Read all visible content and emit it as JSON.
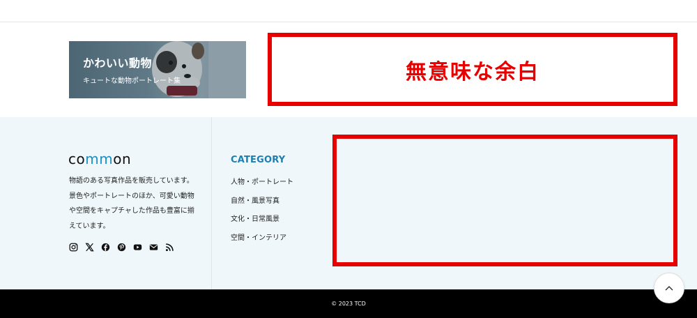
{
  "banner": {
    "title": "かわいい動物",
    "subtitle": "キュートな動物ポートレート集"
  },
  "annotation": {
    "top_label": "無意味な余白",
    "color": "#e60000"
  },
  "footer": {
    "logo": {
      "prefix": "co",
      "highlight": "mm",
      "suffix": "on",
      "accent_color": "#1a8fc4"
    },
    "description_lines": [
      "物語のある写真作品を販売しています。",
      "景色やポートレートのほか、可愛い動物",
      "や空間をキャプチャした作品も豊富に揃",
      "えています。"
    ],
    "socials": [
      "instagram-icon",
      "x-icon",
      "facebook-icon",
      "pinterest-icon",
      "youtube-icon",
      "mail-icon",
      "rss-icon"
    ],
    "category": {
      "heading": "CATEGORY",
      "items": [
        "人物・ポートレート",
        "自然・風景写真",
        "文化・日常風景",
        "空間・インテリア"
      ]
    },
    "copyright": "© 2023 TCD"
  },
  "colors": {
    "footer_bg": "#eff7fa",
    "category_heading": "#1c7fb0",
    "bottom_bar": "#000000"
  }
}
